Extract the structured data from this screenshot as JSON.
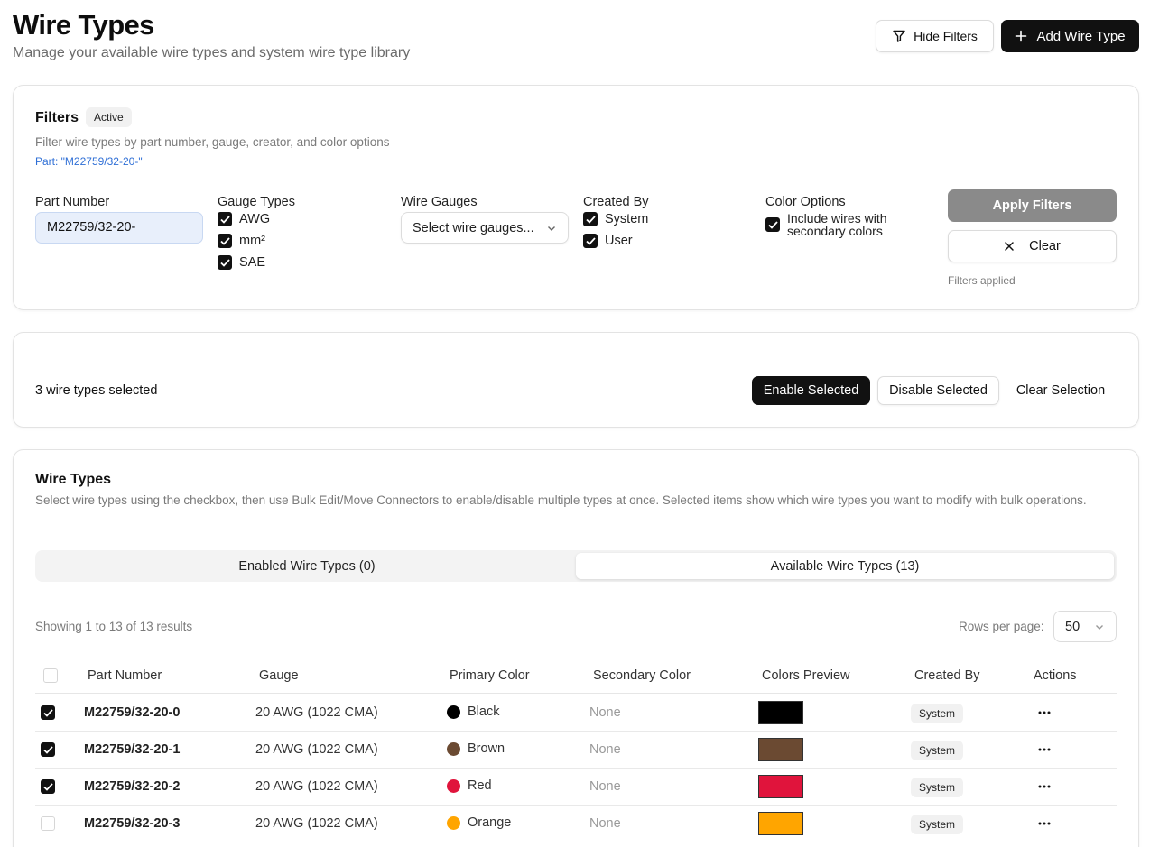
{
  "header": {
    "title": "Wire Types",
    "subtitle": "Manage your available wire types and system wire type library",
    "hide_filters_label": "Hide Filters",
    "add_wire_type_label": "Add Wire Type"
  },
  "filters": {
    "title": "Filters",
    "status_badge": "Active",
    "description": "Filter wire types by part number, gauge, creator, and color options",
    "active_summary": "Part: \"M22759/32-20-\"",
    "part_number": {
      "label": "Part Number",
      "value": "M22759/32-20-"
    },
    "gauge_types": {
      "label": "Gauge Types",
      "options": [
        {
          "label": "AWG",
          "checked": true
        },
        {
          "label": "mm²",
          "checked": true
        },
        {
          "label": "SAE",
          "checked": true
        }
      ]
    },
    "wire_gauges": {
      "label": "Wire Gauges",
      "placeholder": "Select wire gauges..."
    },
    "created_by": {
      "label": "Created By",
      "options": [
        {
          "label": "System",
          "checked": true
        },
        {
          "label": "User",
          "checked": true
        }
      ]
    },
    "color_options": {
      "label": "Color Options",
      "include_secondary_label": "Include wires with secondary colors",
      "include_secondary_checked": true
    },
    "apply_label": "Apply Filters",
    "clear_label": "Clear",
    "applied_status": "Filters applied"
  },
  "selection": {
    "summary": "3 wire types selected",
    "enable_label": "Enable Selected",
    "disable_label": "Disable Selected",
    "clear_label": "Clear Selection"
  },
  "wire_types": {
    "title": "Wire Types",
    "description": "Select wire types using the checkbox, then use Bulk Edit/Move Connectors to enable/disable multiple types at once. Selected items show which wire types you want to modify with bulk operations.",
    "tabs": [
      {
        "label": "Enabled Wire Types (0)",
        "active": false
      },
      {
        "label": "Available Wire Types (13)",
        "active": true
      }
    ],
    "showing": "Showing 1 to 13 of 13 results",
    "rows_per_page_label": "Rows per page:",
    "rows_per_page_value": "50",
    "columns": [
      "Part Number",
      "Gauge",
      "Primary Color",
      "Secondary Color",
      "Colors Preview",
      "Created By",
      "Actions"
    ],
    "rows": [
      {
        "selected": true,
        "part_number": "M22759/32-20-0",
        "gauge": "20 AWG (1022 CMA)",
        "primary_color": "Black",
        "primary_hex": "#000000",
        "secondary_color": "None",
        "created_by": "System"
      },
      {
        "selected": true,
        "part_number": "M22759/32-20-1",
        "gauge": "20 AWG (1022 CMA)",
        "primary_color": "Brown",
        "primary_hex": "#6b4a32",
        "secondary_color": "None",
        "created_by": "System"
      },
      {
        "selected": true,
        "part_number": "M22759/32-20-2",
        "gauge": "20 AWG (1022 CMA)",
        "primary_color": "Red",
        "primary_hex": "#e0143c",
        "secondary_color": "None",
        "created_by": "System"
      },
      {
        "selected": false,
        "part_number": "M22759/32-20-3",
        "gauge": "20 AWG (1022 CMA)",
        "primary_color": "Orange",
        "primary_hex": "#ffa500",
        "secondary_color": "None",
        "created_by": "System"
      }
    ]
  },
  "colors": {
    "accent_dark": "#111111",
    "apply_disabled": "#8a8a8a",
    "part_input_bg": "#e8effb",
    "link_blue": "#2f6fd6"
  }
}
